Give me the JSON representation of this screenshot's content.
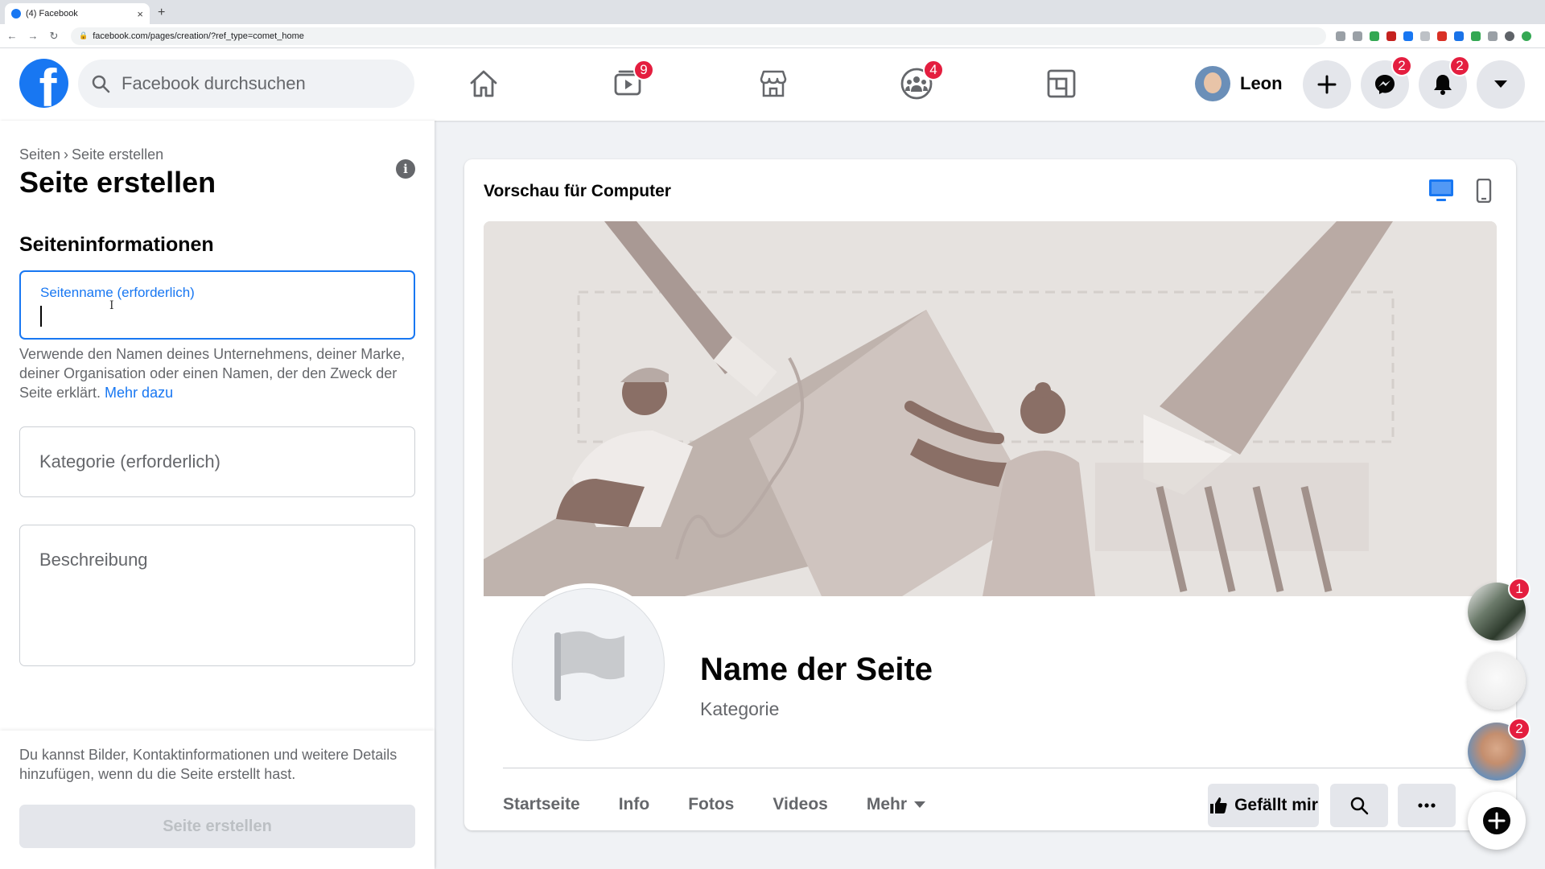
{
  "browser": {
    "tab_title": "(4) Facebook",
    "tab_close": "×",
    "new_tab": "+",
    "url": "facebook.com/pages/creation/?ref_type=comet_home"
  },
  "header": {
    "logo_letter": "f",
    "search_placeholder": "Facebook durchsuchen",
    "watch_badge": "9",
    "groups_badge": "4",
    "profile_name": "Leon",
    "messenger_badge": "2",
    "notifications_badge": "2"
  },
  "sidebar": {
    "breadcrumb_parent": "Seiten",
    "breadcrumb_sep": "›",
    "breadcrumb_current": "Seite erstellen",
    "title": "Seite erstellen",
    "info_glyph": "i",
    "section_title": "Seiteninformationen",
    "page_name_label": "Seitenname (erforderlich)",
    "page_name_value": "",
    "help_text": "Verwende den Namen deines Unternehmens, deiner Marke, deiner Organisation oder einen Namen, der den Zweck der Seite erklärt. ",
    "help_link": "Mehr dazu",
    "category_placeholder": "Kategorie (erforderlich)",
    "description_placeholder": "Beschreibung",
    "footer_text": "Du kannst Bilder, Kontaktinformationen und weitere Details hinzufügen, wenn du die Seite erstellt hast.",
    "create_button": "Seite erstellen"
  },
  "preview": {
    "title": "Vorschau für Computer",
    "page_name": "Name der Seite",
    "category": "Kategorie",
    "tabs": [
      "Startseite",
      "Info",
      "Fotos",
      "Videos"
    ],
    "more_tab": "Mehr",
    "like_button": "Gefällt mir"
  },
  "floating_chats": {
    "chat1_badge": "1",
    "chat3_badge": "2"
  },
  "colors": {
    "brand": "#1877f2",
    "badge": "#e41e3f"
  }
}
